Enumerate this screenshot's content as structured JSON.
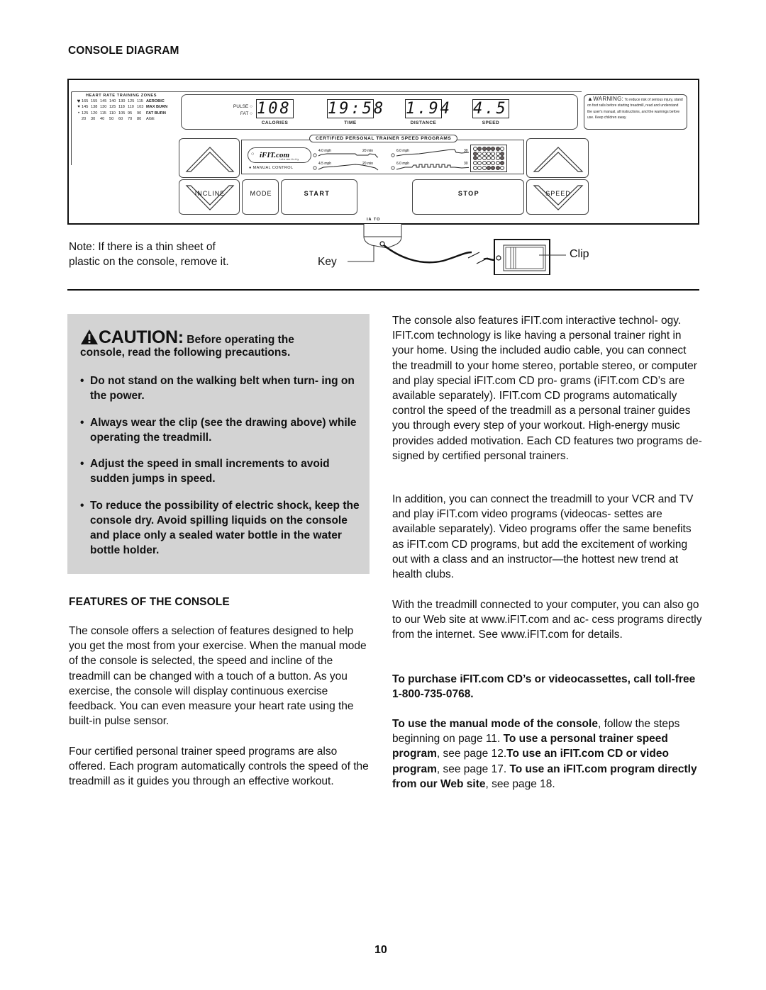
{
  "page": {
    "page_number": "10"
  },
  "console_diagram": {
    "heading": "CONSOLE DIAGRAM",
    "heart_rate_zones": {
      "title": "HEART RATE TRAINING ZONES",
      "rows": [
        {
          "marker": "large-heart",
          "values": [
            "165",
            "155",
            "145",
            "140",
            "130",
            "125",
            "115"
          ],
          "label": "AEROBIC"
        },
        {
          "marker": "medium-heart",
          "values": [
            "145",
            "138",
            "130",
            "125",
            "118",
            "110",
            "103"
          ],
          "label": "MAX BURN"
        },
        {
          "marker": "small-heart",
          "values": [
            "125",
            "120",
            "115",
            "110",
            "105",
            "95",
            "90"
          ],
          "label": "FAT BURN"
        },
        {
          "marker": "",
          "values": [
            "20",
            "30",
            "40",
            "50",
            "60",
            "70",
            "80"
          ],
          "label": "AGE"
        }
      ]
    },
    "indicators": {
      "pulse": "PULSE",
      "fat": "FAT"
    },
    "displays": [
      {
        "value": "108",
        "label": "CALORIES"
      },
      {
        "value": "19:58",
        "label": "TIME"
      },
      {
        "value": "1.94",
        "label": "DISTANCE"
      },
      {
        "value": "4.5",
        "label": "SPEED"
      }
    ],
    "warning": {
      "title": "WARNING:",
      "text": "To reduce risk of serious injury, stand on foot rails before starting treadmill, read and understand the user's manual, all instructions, and the warnings before use. Keep children away."
    },
    "programs": {
      "title": "CERTIFIED PERSONAL TRAINER SPEED PROGRAMS",
      "ifit_logo": "iFIT.com",
      "ifit_sub": "interactivity",
      "manual_control": "MANUAL CONTROL",
      "items": [
        {
          "start": "4.0 mph",
          "end": "20 min"
        },
        {
          "start": "6.0 mph",
          "end": "30 min"
        },
        {
          "start": "4.5 mph",
          "end": "20 min"
        },
        {
          "start": "6.0 mph",
          "end": "30 min"
        }
      ]
    },
    "matrix": [
      [
        0,
        1,
        1,
        1,
        1,
        1,
        0
      ],
      [
        1,
        0,
        0,
        0,
        0,
        0,
        1
      ],
      [
        1,
        0,
        0,
        0,
        0,
        0,
        1
      ],
      [
        0,
        0,
        0,
        0,
        0,
        0,
        1
      ],
      [
        0,
        0,
        0,
        1,
        1,
        1,
        0
      ]
    ],
    "buttons": {
      "incline": "INCLINE",
      "mode": "MODE",
      "start": "START",
      "stop": "STOP",
      "speed": "SPEED"
    },
    "key_label_small": "IA  TO",
    "note": "Note: If there is a thin sheet of plastic on the console, remove it.",
    "note_line1": "Note: If there is a thin sheet of",
    "note_line2": "plastic on the console, remove it.",
    "key_label": "Key",
    "clip_label": "Clip"
  },
  "caution": {
    "icon": "warning-triangle-icon",
    "big": "CAUTION:",
    "small": "Before operating the",
    "line2": "console, read the following precautions.",
    "items": [
      "Do not stand on the walking belt when turn- ing on the power.",
      "Always wear the clip (see the drawing above) while operating the treadmill.",
      "Adjust the speed in small increments to avoid sudden jumps in speed.",
      "To reduce the possibility of electric shock, keep the console dry. Avoid spilling liquids on the console and place only a sealed water bottle in the water bottle holder."
    ]
  },
  "features": {
    "heading": "FEATURES OF THE CONSOLE",
    "paragraphs": [
      "The console offers a selection of features designed to help you get the most from your exercise. When the manual mode of the console is selected, the speed and incline of the treadmill can be changed with a touch of a button. As you exercise, the console will display continuous exercise feedback. You can even measure your heart rate using the built-in pulse sensor.",
      "Four certified personal trainer speed programs are also offered. Each program automatically controls the speed of the treadmill as it guides you through an effective workout."
    ]
  },
  "right_column": {
    "paragraphs": [
      "The console also features iFIT.com interactive technol- ogy. IFIT.com technology is like having a personal trainer right in your home. Using the included audio cable, you can connect the treadmill to your home stereo, portable stereo, or computer and play special iFIT.com CD pro- grams (iFIT.com CD’s are available separately). IFIT.com CD programs automatically control the speed of the treadmill as a personal trainer guides you through every step of your workout. High-energy music provides added motivation. Each CD features two programs de- signed by certified personal trainers.",
      "In addition, you can connect the treadmill to your VCR and TV and play iFIT.com video programs (videocas- settes are available separately). Video programs offer the same benefits as iFIT.com CD programs, but add the excitement of working out with a class and an instructor—the hottest new trend at health clubs.",
      "With the treadmill connected to your computer, you can also go to our Web site at www.iFIT.com and ac- cess programs directly from the internet. See www.iFIT.com for details."
    ],
    "purchase": "To purchase iFIT.com CD’s or videocassettes, call toll-free 1-800-735-0768.",
    "usage": [
      {
        "bold": "To use the manual mode of the console",
        "normal": ", follow the steps beginning on page 11. "
      },
      {
        "bold": "To use a personal trainer speed program",
        "normal": ", see page 12."
      },
      {
        "bold": "To use an iFIT.com CD or video program",
        "normal": ", see page 17. "
      },
      {
        "bold": "To use an iFIT.com program directly from our Web site",
        "normal": ", see page 18."
      }
    ]
  }
}
